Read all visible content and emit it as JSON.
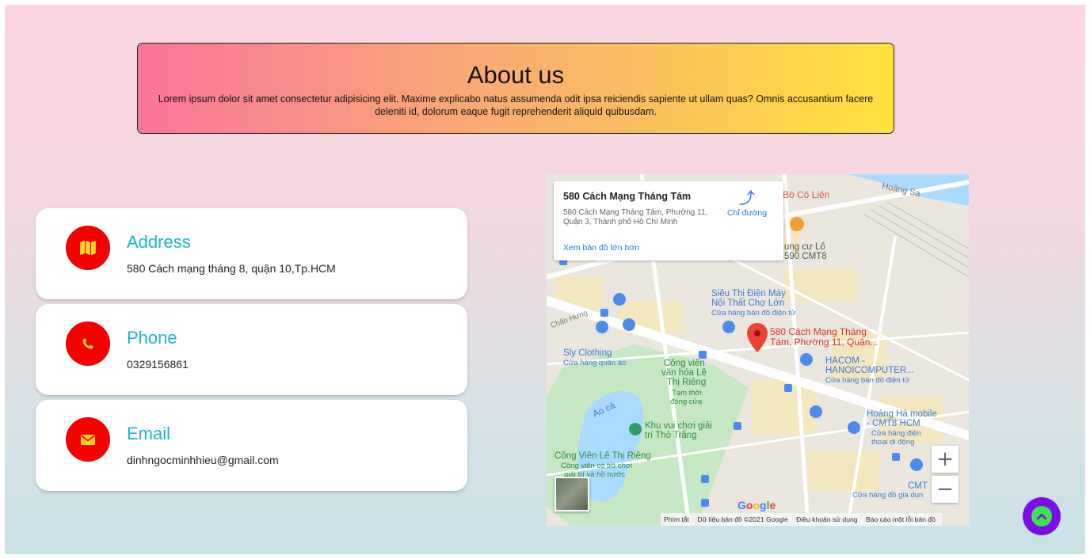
{
  "about": {
    "title": "About us",
    "text": "Lorem ipsum dolor sit amet consectetur adipisicing elit. Maxime explicabo natus assumenda odit ipsa reiciendis sapiente ut ullam quas? Omnis accusantium facere deleniti id, dolorum eaque fugit reprehenderit aliquid quibusdam."
  },
  "contacts": [
    {
      "title": "Address",
      "value": "580 Cách mạng tháng 8, quận 10,Tp.HCM",
      "icon": "map-icon"
    },
    {
      "title": "Phone",
      "value": "0329156861",
      "icon": "phone-icon"
    },
    {
      "title": "Email",
      "value": "dinhngocminhhieu@gmail.com",
      "icon": "envelope-icon"
    }
  ],
  "map": {
    "place_name": "580 Cách Mạng Tháng Tám",
    "place_address": "580 Cách Mạng Tháng Tám, Phường 11, Quận 3, Thành phố Hồ Chí Minh",
    "directions": "Chỉ đường",
    "larger_map": "Xem bản đồ lớn hơn",
    "labels": {
      "hoang_sa": "Hoàng Sa",
      "bo_co_lien": "Bò Cô Liên",
      "chung_cu_line1": "ung cư Lô",
      "chung_cu_line2": "590 CMT8",
      "sieu_thi_line1": "Siêu Thị Điện Máy",
      "sieu_thi_line2": "Nội Thất Chợ Lớn",
      "sieu_thi_sub": "Cửa hàng bán đồ điện tử",
      "chan_hung": "Chấn Hưng",
      "pin_line1": "580 Cách Mạng Tháng",
      "pin_line2": "Tám, Phường 11, Quận...",
      "sly_clothing": "Sly Clothing",
      "sly_sub": "Cửa hàng quần áo",
      "cong_vien_line1": "Công viên",
      "cong_vien_line2": "văn hóa Lê",
      "cong_vien_line3": "Thị Riêng",
      "cong_vien_sub1": "Tạm thời",
      "cong_vien_sub2": "đóng cửa",
      "hacom_line1": "HACOM -",
      "hacom_line2": "HANOICOMPUTER...",
      "hacom_sub": "Cửa hàng bán đồ điện tử",
      "ao_ca": "Ao cá",
      "khu_vui_line1": "Khu vui chơi giải",
      "khu_vui_line2": "trí Thỏ Trắng",
      "hoang_ha_line1": "Hoàng Hà mobile",
      "hoang_ha_line2": "- CMT8 HCM",
      "hoang_ha_sub1": "Cửa hàng điện",
      "hoang_ha_sub2": "thoại di động",
      "cvlt_line1": "Công Viên Lê Thị Riêng",
      "cvlt_sub1": "Công viên có trò chơi",
      "cvlt_sub2": "giải trí và hồ nước",
      "cmt": "CMT",
      "cmt_sub": "Cửa hàng đồ gia dụn"
    },
    "zoom_in": "+",
    "zoom_out": "−",
    "google": "Google",
    "footer": [
      "Phím tắt",
      "Dữ liệu bản đồ ©2021 Google",
      "Điều khoản sử dụng",
      "Báo cáo một lỗi bản đồ"
    ]
  },
  "colors": {
    "accent_title": "#16b6c9",
    "icon_bg": "#f40000",
    "icon_fg": "#ffd21f",
    "totop_bg": "#7f0ce8",
    "totop_fg": "#3ee24f"
  },
  "back_to_top_icon": "chevron-up-icon"
}
